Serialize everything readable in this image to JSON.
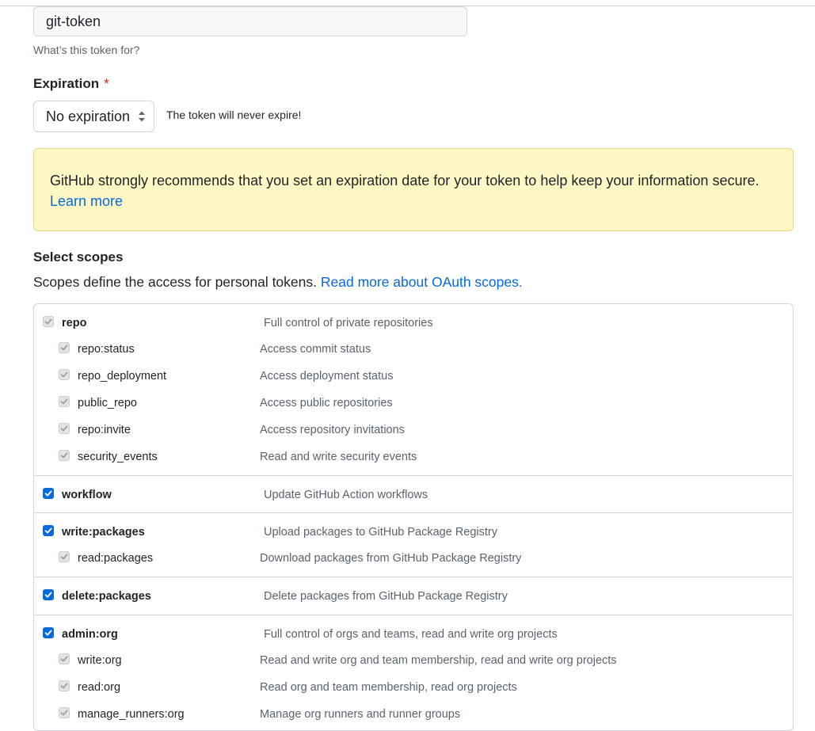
{
  "note": {
    "value": "git-token",
    "help": "What’s this token for?"
  },
  "expiration": {
    "label": "Expiration",
    "required_mark": "*",
    "selected": "No expiration",
    "hint": "The token will never expire!"
  },
  "warning": {
    "text": "GitHub strongly recommends that you set an expiration date for your token to help keep your information secure.",
    "link": "Learn more"
  },
  "scopes": {
    "title": "Select scopes",
    "description": "Scopes define the access for personal tokens.",
    "link": "Read more about OAuth scopes.",
    "groups": [
      {
        "name": "repo",
        "desc": "Full control of private repositories",
        "checked": false,
        "children": [
          {
            "name": "repo:status",
            "desc": "Access commit status"
          },
          {
            "name": "repo_deployment",
            "desc": "Access deployment status"
          },
          {
            "name": "public_repo",
            "desc": "Access public repositories"
          },
          {
            "name": "repo:invite",
            "desc": "Access repository invitations"
          },
          {
            "name": "security_events",
            "desc": "Read and write security events"
          }
        ]
      },
      {
        "name": "workflow",
        "desc": "Update GitHub Action workflows",
        "checked": true,
        "children": []
      },
      {
        "name": "write:packages",
        "desc": "Upload packages to GitHub Package Registry",
        "checked": true,
        "children": [
          {
            "name": "read:packages",
            "desc": "Download packages from GitHub Package Registry"
          }
        ]
      },
      {
        "name": "delete:packages",
        "desc": "Delete packages from GitHub Package Registry",
        "checked": true,
        "children": []
      },
      {
        "name": "admin:org",
        "desc": "Full control of orgs and teams, read and write org projects",
        "checked": true,
        "children": [
          {
            "name": "write:org",
            "desc": "Read and write org and team membership, read and write org projects"
          },
          {
            "name": "read:org",
            "desc": "Read org and team membership, read org projects"
          },
          {
            "name": "manage_runners:org",
            "desc": "Manage org runners and runner groups"
          }
        ]
      }
    ]
  },
  "colors": {
    "accent": "#0969da",
    "warning_bg": "#fff8c5",
    "danger": "#d1242f"
  }
}
